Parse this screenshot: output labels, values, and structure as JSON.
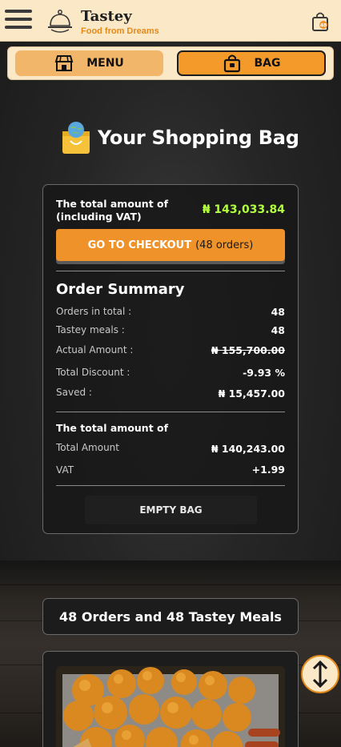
{
  "header": {
    "brand": "Tastey",
    "tagline": "Food from Dreams",
    "bag_count": "48"
  },
  "nav": {
    "menu_label": "MENU",
    "bag_label": "BAG"
  },
  "page": {
    "title": "Your Shopping Bag"
  },
  "summary_card": {
    "total_label": "The total amount of (including VAT)",
    "total_value": "₦ 143,033.84",
    "checkout_label": "GO TO CHECKOUT",
    "checkout_count": "(48 orders)",
    "order_summary_title": "Order Summary",
    "rows": [
      {
        "label": "Orders in total :",
        "value": "48"
      },
      {
        "label": "Tastey meals :",
        "value": "48"
      },
      {
        "label": "Actual Amount :",
        "value": "₦ 155,700.00"
      },
      {
        "label": "Total Discount :",
        "value": "-9.93 %"
      },
      {
        "label": "Saved :",
        "value": "₦ 15,457.00"
      }
    ],
    "total_section_title": "The total amount of",
    "total_rows": [
      {
        "label": "Total Amount",
        "value": "₦ 140,243.00"
      },
      {
        "label": "VAT",
        "value": "+1.99"
      }
    ],
    "empty_bag_label": "EMPTY BAG"
  },
  "orders_heading": "48 Orders and 48 Tastey Meals",
  "colors": {
    "brand_orange": "#ef922a",
    "header_bg": "#fbe8c6",
    "total_value_green": "#b2ff3c"
  },
  "icons": [
    "menu-hamburger-icon",
    "cloche-logo-icon",
    "shopping-bag-icon",
    "store-icon",
    "globe-bag-icon",
    "scroll-toggle-icon"
  ]
}
